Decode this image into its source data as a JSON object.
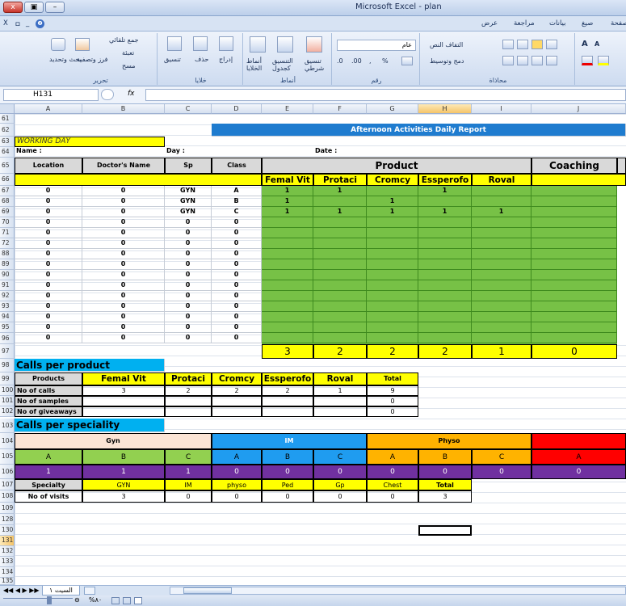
{
  "window": {
    "title": "Microsoft Excel - plan"
  },
  "title_buttons": [
    "x",
    "▣",
    "–"
  ],
  "mdi_buttons": [
    "X",
    "ㅁ",
    "_",
    "❷"
  ],
  "ribbon_tabs": [
    "صفحة",
    "صيغ",
    "بيانات",
    "مراجعة",
    "عرض"
  ],
  "ribbon": {
    "editing": {
      "label": "تحرير",
      "sum": "جمع تلقائي",
      "fill": "تعبئة",
      "clear": "مسح",
      "sort": "فرز وتصفية",
      "find": "بحث وتحديد"
    },
    "cells": {
      "label": "خلايا",
      "insert": "إدراج",
      "delete": "حذف",
      "format": "تنسيق"
    },
    "styles": {
      "label": "أنماط",
      "cond": "تنسيق شرطي",
      "table": "التنسيق كجدول",
      "cellstyles": "أنماط الخلايا"
    },
    "number": {
      "label": "رقم",
      "format": "عام",
      "pct": "%",
      "comma": ",",
      "inc": ".00",
      "dec": ".0"
    },
    "alignment": {
      "label": "محاذاة",
      "wrap": "التفاف النص",
      "merge": "دمج وتوسيط"
    },
    "font": {
      "grow": "A",
      "shrink": "A"
    }
  },
  "namebox": "H131",
  "fx": "fx",
  "columns": [
    "A",
    "B",
    "C",
    "D",
    "E",
    "F",
    "G",
    "H",
    "I",
    "J"
  ],
  "rows": [
    "61",
    "62",
    "63",
    "64",
    "65",
    "66",
    "67",
    "68",
    "69",
    "70",
    "71",
    "72",
    "88",
    "89",
    "90",
    "91",
    "92",
    "93",
    "94",
    "95",
    "96",
    "97",
    "98",
    "99",
    "100",
    "101",
    "102",
    "103",
    "104",
    "105",
    "106",
    "107",
    "108",
    "109",
    "128",
    "130",
    "131",
    "132",
    "133",
    "134",
    "135",
    "136"
  ],
  "report": {
    "title": "Afternoon Activities Daily Report",
    "working_day": "WORKING DAY",
    "name": "Name :",
    "day": "Day :",
    "date": "Date :",
    "headers": [
      "Location",
      "Doctor's Name",
      "Sp",
      "Class"
    ],
    "product": "Product",
    "coaching": "Coaching",
    "products": [
      "Femal Vit",
      "Protaci",
      "Cromcy",
      "Essperofo",
      "Roval"
    ],
    "rows": [
      {
        "loc": "0",
        "doc": "0",
        "sp": "GYN",
        "cls": "A",
        "p": [
          "1",
          "1",
          "",
          "1",
          ""
        ]
      },
      {
        "loc": "0",
        "doc": "0",
        "sp": "GYN",
        "cls": "B",
        "p": [
          "1",
          "",
          "1",
          "",
          ""
        ]
      },
      {
        "loc": "0",
        "doc": "0",
        "sp": "GYN",
        "cls": "C",
        "p": [
          "1",
          "1",
          "1",
          "1",
          "1"
        ]
      },
      {
        "loc": "0",
        "doc": "0",
        "sp": "0",
        "cls": "0",
        "p": [
          "",
          "",
          "",
          "",
          ""
        ]
      },
      {
        "loc": "0",
        "doc": "0",
        "sp": "0",
        "cls": "0",
        "p": [
          "",
          "",
          "",
          "",
          ""
        ]
      },
      {
        "loc": "0",
        "doc": "0",
        "sp": "0",
        "cls": "0",
        "p": [
          "",
          "",
          "",
          "",
          ""
        ]
      },
      {
        "loc": "0",
        "doc": "0",
        "sp": "0",
        "cls": "0",
        "p": [
          "",
          "",
          "",
          "",
          ""
        ]
      },
      {
        "loc": "0",
        "doc": "0",
        "sp": "0",
        "cls": "0",
        "p": [
          "",
          "",
          "",
          "",
          ""
        ]
      },
      {
        "loc": "0",
        "doc": "0",
        "sp": "0",
        "cls": "0",
        "p": [
          "",
          "",
          "",
          "",
          ""
        ]
      },
      {
        "loc": "0",
        "doc": "0",
        "sp": "0",
        "cls": "0",
        "p": [
          "",
          "",
          "",
          "",
          ""
        ]
      },
      {
        "loc": "0",
        "doc": "0",
        "sp": "0",
        "cls": "0",
        "p": [
          "",
          "",
          "",
          "",
          ""
        ]
      },
      {
        "loc": "0",
        "doc": "0",
        "sp": "0",
        "cls": "0",
        "p": [
          "",
          "",
          "",
          "",
          ""
        ]
      },
      {
        "loc": "0",
        "doc": "0",
        "sp": "0",
        "cls": "0",
        "p": [
          "",
          "",
          "",
          "",
          ""
        ]
      },
      {
        "loc": "0",
        "doc": "0",
        "sp": "0",
        "cls": "0",
        "p": [
          "",
          "",
          "",
          "",
          ""
        ]
      },
      {
        "loc": "0",
        "doc": "0",
        "sp": "0",
        "cls": "0",
        "p": [
          "",
          "",
          "",
          "",
          ""
        ]
      }
    ],
    "totals": [
      "3",
      "2",
      "2",
      "2",
      "1",
      "0"
    ],
    "calls_per_product": "Calls per product",
    "cpp_header": "Products",
    "cpp_total": "Total",
    "cpp_rows": [
      {
        "label": "No of calls",
        "v": [
          "3",
          "2",
          "2",
          "2",
          "1"
        ],
        "t": "9"
      },
      {
        "label": "No of samples",
        "v": [
          "",
          "",
          "",
          "",
          ""
        ],
        "t": "0"
      },
      {
        "label": "No of giveaways",
        "v": [
          "",
          "",
          "",
          "",
          ""
        ],
        "t": "0"
      }
    ],
    "calls_per_speciality": "Calls per speciality",
    "spec_groups": [
      "Gyn",
      "IM",
      "Physo"
    ],
    "spec_letters": [
      "A",
      "B",
      "C",
      "A",
      "B",
      "C",
      "A",
      "B",
      "C",
      "A"
    ],
    "spec_values": [
      "1",
      "1",
      "1",
      "0",
      "0",
      "0",
      "0",
      "0",
      "0",
      "0"
    ],
    "visits_header": [
      "Specialty",
      "GYN",
      "IM",
      "physo",
      "Ped",
      "Gp",
      "Chest",
      "Total"
    ],
    "visits_row": [
      "No of visits",
      "3",
      "0",
      "0",
      "0",
      "0",
      "0",
      "3"
    ]
  },
  "sheet_tab": "السيت ١",
  "status": {
    "zoom": "%٨٠"
  },
  "colors": {
    "yellow": "#ffff00",
    "green": "#77c146",
    "blue": "#1f7ccf",
    "cyan": "#00b0f0",
    "peach": "#fbe4d5",
    "orange": "#ffb300",
    "red": "#ff0000",
    "purple": "#7030a0",
    "lightgreen": "#92d050"
  }
}
